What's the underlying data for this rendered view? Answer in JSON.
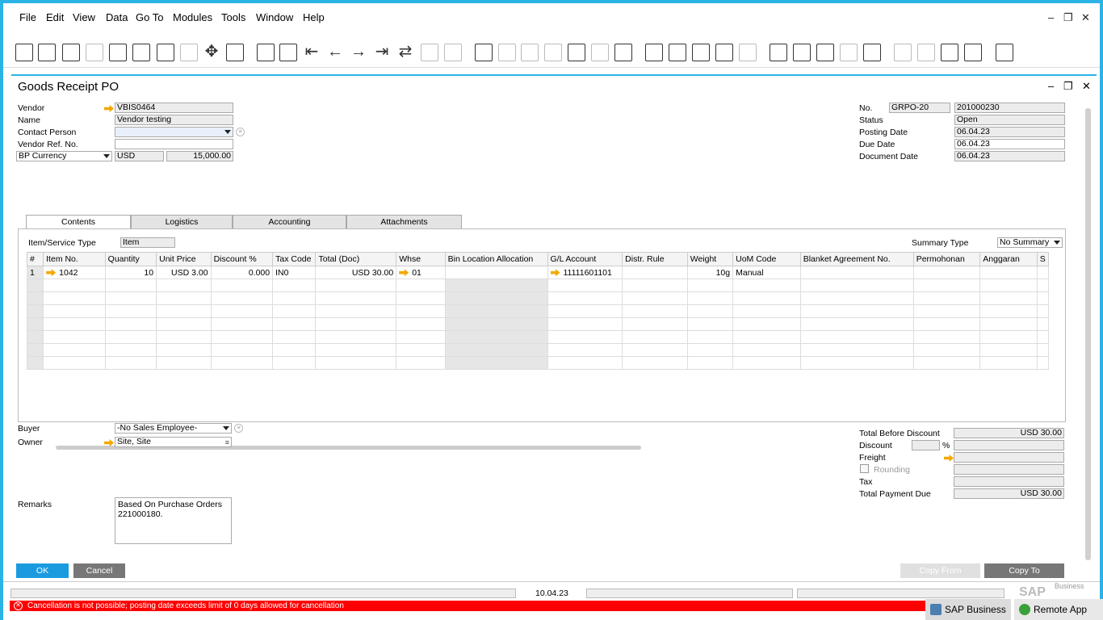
{
  "menu": [
    "File",
    "Edit",
    "View",
    "Data",
    "Go To",
    "Modules",
    "Tools",
    "Window",
    "Help"
  ],
  "window_controls": {
    "minimize": "–",
    "restore": "❐",
    "close": "✕"
  },
  "doc": {
    "title": "Goods Receipt PO"
  },
  "header_left": {
    "vendor_label": "Vendor",
    "vendor_value": "VBIS0464",
    "name_label": "Name",
    "name_value": "Vendor testing",
    "contact_label": "Contact Person",
    "contact_value": "",
    "ref_label": "Vendor Ref. No.",
    "ref_value": "",
    "currency_select": "BP Currency",
    "currency_value": "USD",
    "amount_value": "15,000.00"
  },
  "header_right": {
    "no_label": "No.",
    "series": "GRPO-20",
    "number": "201000230",
    "status_label": "Status",
    "status_value": "Open",
    "posting_label": "Posting Date",
    "posting_value": "06.04.23",
    "due_label": "Due Date",
    "due_value": "06.04.23",
    "docdate_label": "Document Date",
    "docdate_value": "06.04.23"
  },
  "tabs": [
    "Contents",
    "Logistics",
    "Accounting",
    "Attachments"
  ],
  "contents": {
    "type_label": "Item/Service Type",
    "type_value": "Item",
    "summary_label": "Summary Type",
    "summary_value": "No Summary"
  },
  "grid": {
    "columns": [
      "#",
      "Item No.",
      "Quantity",
      "Unit Price",
      "Discount %",
      "Tax Code",
      "Total (Doc)",
      "Whse",
      "Bin Location Allocation",
      "G/L Account",
      "Distr. Rule",
      "Weight",
      "UoM Code",
      "Blanket Agreement No.",
      "Permohonan",
      "Anggaran",
      "S"
    ],
    "rows": [
      [
        "1",
        "1042",
        "10",
        "USD 3.00",
        "0.000",
        "IN0",
        "USD 30.00",
        "01",
        "",
        "11111601101",
        "",
        "10g",
        "Manual",
        "",
        "",
        "",
        ""
      ]
    ]
  },
  "footer_left": {
    "buyer_label": "Buyer",
    "buyer_value": "-No Sales Employee-",
    "owner_label": "Owner",
    "owner_value": "Site, Site",
    "remarks_label": "Remarks",
    "remarks_line1": "Based On Purchase Orders",
    "remarks_line2": "221000180."
  },
  "footer_right": {
    "total_before_label": "Total Before Discount",
    "total_before_value": "USD 30.00",
    "discount_label": "Discount",
    "discount_pct": "",
    "pct_sign": "%",
    "discount_value": "",
    "freight_label": "Freight",
    "freight_value": "",
    "rounding_label": "Rounding",
    "rounding_value": "",
    "tax_label": "Tax",
    "tax_value": "",
    "total_due_label": "Total Payment Due",
    "total_due_value": "USD 30.00"
  },
  "buttons": {
    "ok": "OK",
    "cancel": "Cancel",
    "copy_from": "Copy From",
    "copy_to": "Copy To"
  },
  "status_bar": {
    "date": "10.04.23",
    "error": "Cancellation is not possible; posting date exceeds limit of 0 days allowed for cancellation"
  },
  "brand": {
    "sap": "SAP",
    "business": "Business"
  },
  "taskbar": {
    "app1": "SAP Business ...",
    "app2": "Remote App"
  },
  "colors": {
    "accent": "#2bb3e6",
    "ok_button": "#1a9be0",
    "cancel_button": "#777777",
    "error": "#ff0000",
    "link_arrow": "#f2a900"
  }
}
